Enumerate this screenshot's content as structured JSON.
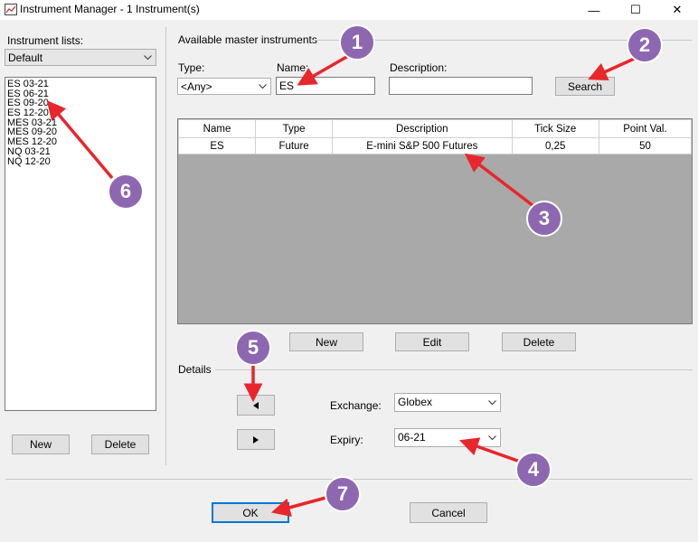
{
  "window": {
    "title": "Instrument Manager - 1 Instrument(s)",
    "minimize": "—",
    "maximize": "☐",
    "close": "✕"
  },
  "left": {
    "lists_label": "Instrument lists:",
    "selected_list": "Default",
    "instruments": [
      "ES 03-21",
      "ES 06-21",
      "ES 09-20",
      "ES 12-20",
      "MES 03-21",
      "MES 09-20",
      "MES 12-20",
      "NQ 03-21",
      "NQ 12-20"
    ],
    "new_label": "New",
    "delete_label": "Delete"
  },
  "master": {
    "group_label": "Available master instruments",
    "type_label": "Type:",
    "type_value": "<Any>",
    "name_label": "Name:",
    "name_value": "ES",
    "description_label": "Description:",
    "description_value": "",
    "search_label": "Search",
    "columns": [
      "Name",
      "Type",
      "Description",
      "Tick Size",
      "Point Val."
    ],
    "rows": [
      [
        "ES",
        "Future",
        "E-mini S&P 500 Futures",
        "0,25",
        "50"
      ]
    ],
    "new_label": "New",
    "edit_label": "Edit",
    "delete_label": "Delete"
  },
  "details": {
    "group_label": "Details",
    "exchange_label": "Exchange:",
    "exchange_value": "Globex",
    "expiry_label": "Expiry:",
    "expiry_value": "06-21"
  },
  "footer": {
    "ok_label": "OK",
    "cancel_label": "Cancel"
  },
  "callouts": [
    "1",
    "2",
    "3",
    "4",
    "5",
    "6",
    "7"
  ],
  "colors": {
    "callout": "#8e67b1",
    "arrow": "#e8262b"
  }
}
